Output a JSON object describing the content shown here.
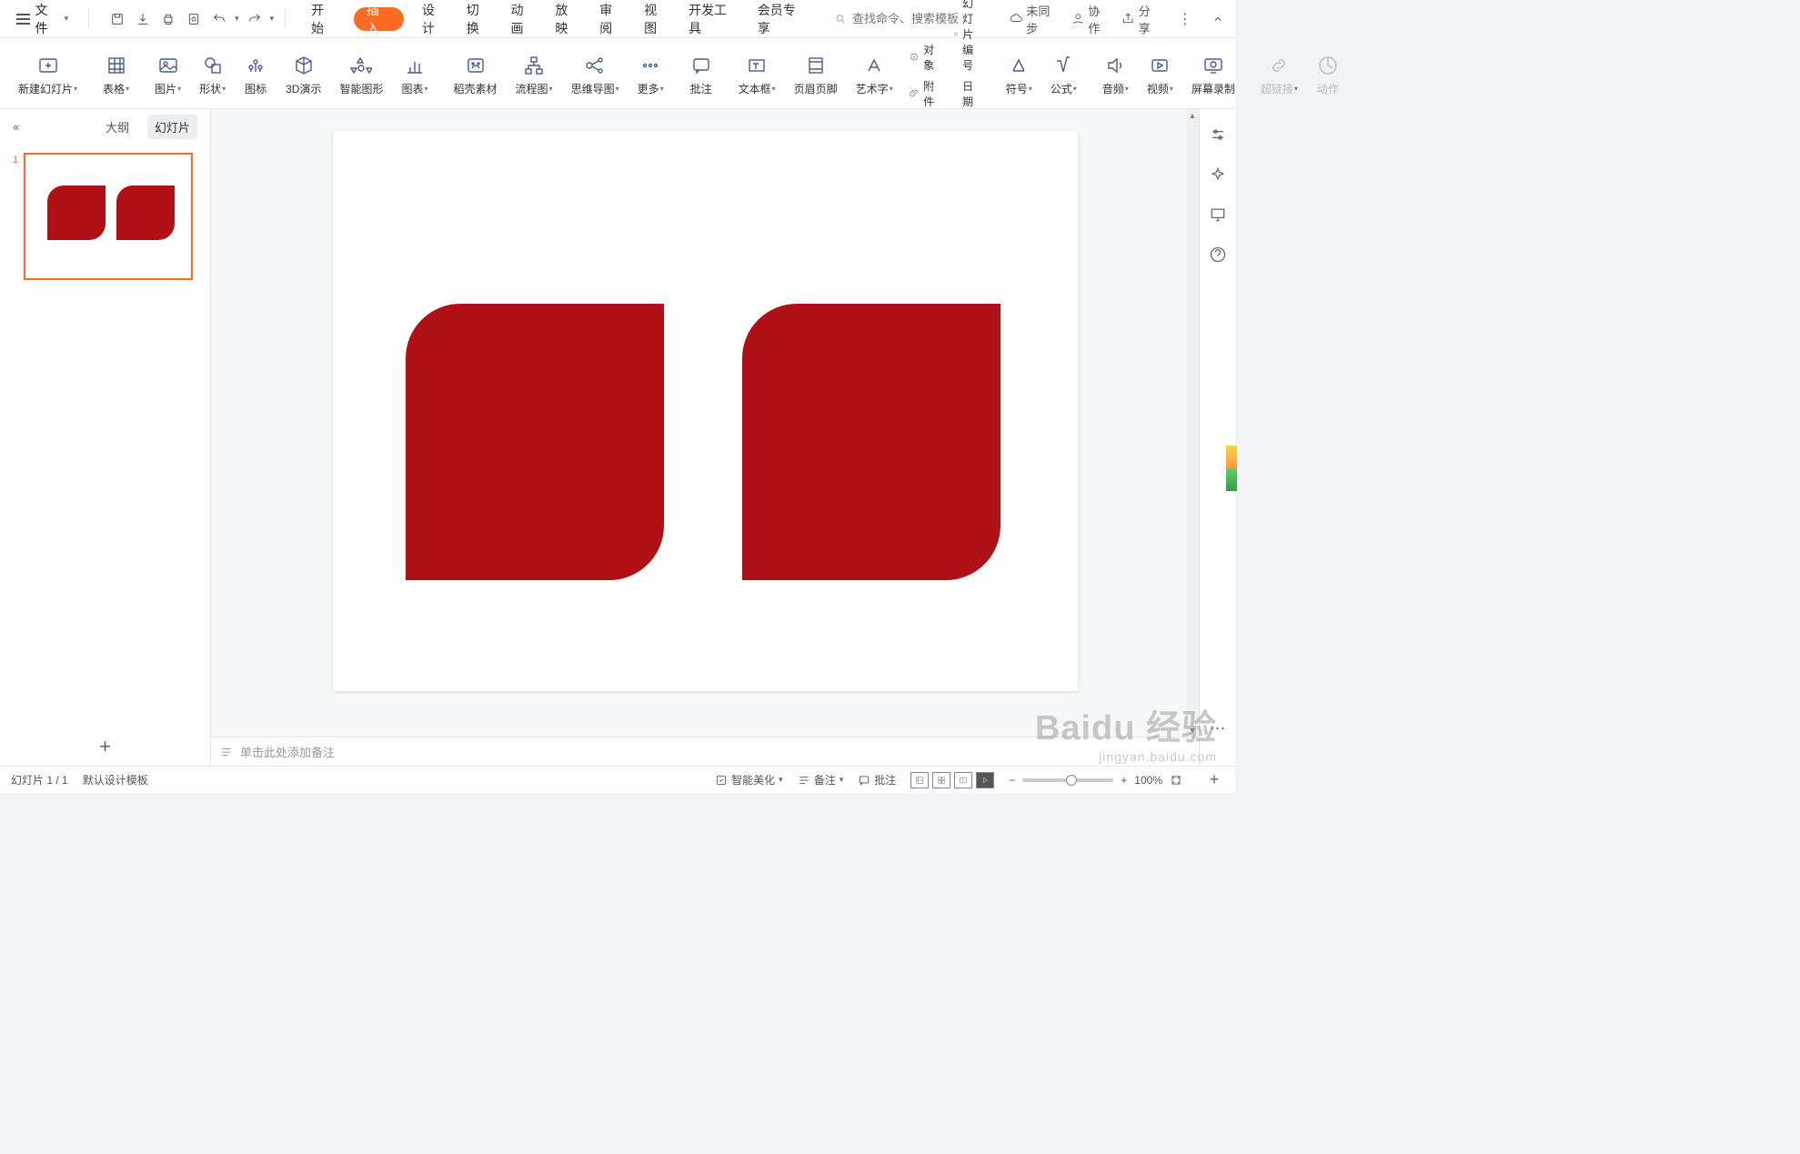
{
  "menubar": {
    "file": "文件",
    "tabs": [
      "开始",
      "插入",
      "设计",
      "切换",
      "动画",
      "放映",
      "审阅",
      "视图",
      "开发工具",
      "会员专享"
    ],
    "active_tab_index": 1,
    "search_placeholder": "查找命令、搜索模板",
    "unsynced": "未同步",
    "collab": "协作",
    "share": "分享"
  },
  "ribbon": {
    "new_slide": "新建幻灯片",
    "table": "表格",
    "picture": "图片",
    "shapes": "形状",
    "icons": "图标",
    "threed": "3D演示",
    "smartart": "智能图形",
    "chart": "图表",
    "daoke": "稻壳素材",
    "flowchart": "流程图",
    "mindmap": "思维导图",
    "more": "更多",
    "comment": "批注",
    "textbox": "文本框",
    "headerfooter": "页眉页脚",
    "wordart": "艺术字",
    "object": "对象",
    "attachment": "附件",
    "slidenum": "幻灯片编号",
    "datetime": "日期和时间",
    "symbol": "符号",
    "equation": "公式",
    "audio": "音频",
    "video": "视频",
    "screenrec": "屏幕录制",
    "hyperlink": "超链接",
    "action": "动作"
  },
  "leftpane": {
    "outline": "大纲",
    "slides": "幻灯片",
    "collapse": "«",
    "slide_number": "1"
  },
  "notes": {
    "placeholder": "单击此处添加备注"
  },
  "statusbar": {
    "slide_indicator": "幻灯片 1 / 1",
    "template": "默认设计模板",
    "beautify": "智能美化",
    "notes": "备注",
    "comments": "批注",
    "zoom_value": "100%",
    "zoom_minus": "−",
    "zoom_plus": "+"
  },
  "watermark": {
    "brand": "Baidu 经验",
    "url": "jingyan.baidu.com"
  },
  "colors": {
    "accent": "#fd6b22",
    "shape": "#b01116"
  }
}
